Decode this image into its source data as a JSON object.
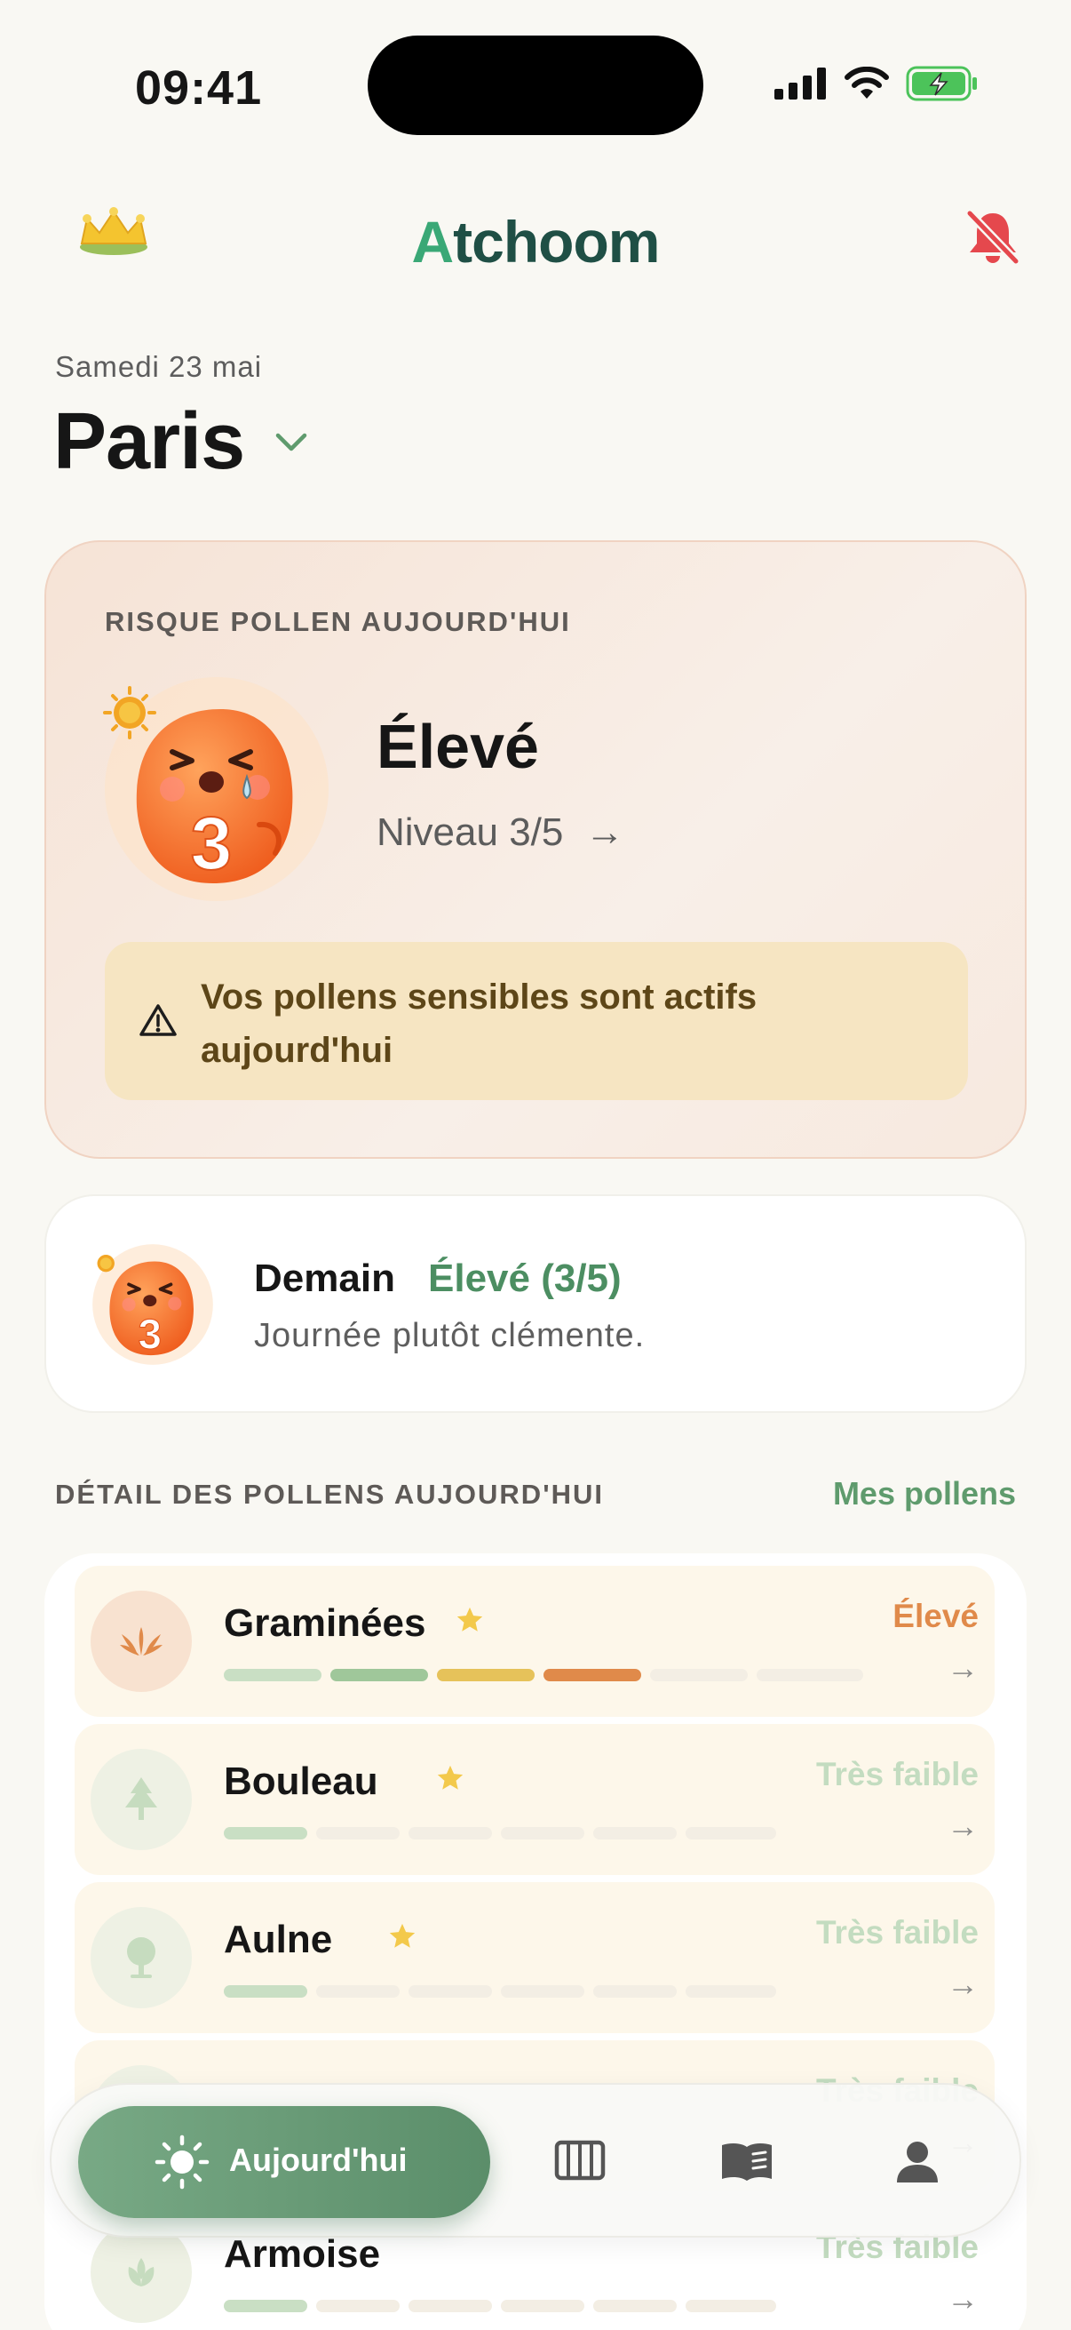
{
  "status_bar": {
    "time": "09:41"
  },
  "header": {
    "logo_prefix": "A",
    "logo_rest": "tchoom"
  },
  "location": {
    "date": "Samedi 23 mai",
    "city": "Paris"
  },
  "risk_today": {
    "label": "RISQUE POLLEN AUJOURD'HUI",
    "level_name": "Élevé",
    "level_detail": "Niveau 3/5",
    "level_number": "3",
    "level_value": 3,
    "level_max": 5,
    "arrow": "→",
    "alert": "Vos pollens sensibles sont actifs aujourd'hui"
  },
  "tomorrow": {
    "title": "Demain",
    "level": "Élevé (3/5)",
    "level_number": "3",
    "subtitle": "Journée plutôt clémente."
  },
  "pollen_section": {
    "title": "DÉTAIL DES POLLENS AUJOURD'HUI",
    "link": "Mes pollens"
  },
  "pollens": [
    {
      "name": "Graminées",
      "favorite": true,
      "level": "Élevé",
      "level_value": 4,
      "arrow": "→",
      "icon": "grass-icon",
      "color": "#e08a4a"
    },
    {
      "name": "Bouleau",
      "favorite": true,
      "level": "Très faible",
      "level_value": 1,
      "arrow": "→",
      "icon": "tree-icon",
      "color": "#b7d7b8"
    },
    {
      "name": "Aulne",
      "favorite": true,
      "level": "Très faible",
      "level_value": 1,
      "arrow": "→",
      "icon": "alder-tree-icon",
      "color": "#b7d7b8"
    },
    {
      "name": "",
      "favorite": false,
      "level": "Très faible",
      "level_value": 1,
      "arrow": "→",
      "icon": "plant-icon",
      "color": "#b7d7b8"
    },
    {
      "name": "Armoise",
      "favorite": false,
      "level": "Très faible",
      "level_value": 1,
      "arrow": "→",
      "icon": "leaf-icon",
      "color": "#b7d7b8"
    }
  ],
  "tabbar": {
    "active_label": "Aujourd'hui",
    "tabs": [
      "sun-icon",
      "calendar-icon",
      "book-icon",
      "profile-icon"
    ]
  },
  "colors": {
    "accent_green": "#5f9b6d",
    "brand_dark": "#1f4f45",
    "orange_high": "#e08a4a",
    "bell_red": "#e5484d"
  }
}
